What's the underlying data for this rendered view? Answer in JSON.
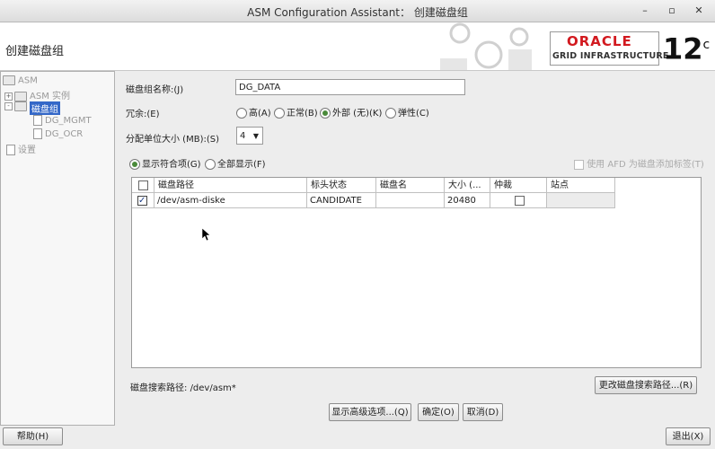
{
  "window": {
    "title": "ASM Configuration Assistant： 创建磁盘组",
    "minimize": "–",
    "maximize": "▫",
    "close": "✕"
  },
  "header": {
    "title": "创建磁盘组",
    "brand": "ORACLE",
    "product": "GRID INFRASTRUCTURE",
    "version": "12",
    "version_suffix": "c"
  },
  "tree": {
    "root": "ASM",
    "instances": "ASM 实例",
    "diskgroups": "磁盘组",
    "dg1": "DG_MGMT",
    "dg2": "DG_OCR",
    "settings": "设置"
  },
  "form": {
    "name_label": "磁盘组名称:(J)",
    "name_value": "DG_DATA",
    "redundancy_label": "冗余:(E)",
    "redundancy_options": [
      "高(A)",
      "正常(B)",
      "外部 (无)(K)",
      "弹性(C)"
    ],
    "redundancy_selected": "外部 (无)(K)",
    "au_label": "分配单位大小 (MB):(S)",
    "au_value": "4",
    "show_eligible": "显示符合项(G)",
    "show_all": "全部显示(F)",
    "afd_label": "使用 AFD 为磁盘添加标签(T)"
  },
  "table": {
    "columns": [
      "磁盘路径",
      "标头状态",
      "磁盘名",
      "大小 (...",
      "仲裁",
      "站点"
    ],
    "rows": [
      {
        "path": "/dev/asm-diske",
        "status": "CANDIDATE",
        "name": "",
        "size": "20480",
        "quorum": false,
        "site": "",
        "selected": true
      }
    ]
  },
  "search_path": {
    "label": "磁盘搜索路径:",
    "value": "/dev/asm*",
    "change_button": "更改磁盘搜索路径...(R)"
  },
  "buttons": {
    "advanced": "显示高级选项...(Q)",
    "ok": "确定(O)",
    "cancel": "取消(D)",
    "help": "帮助(H)",
    "exit": "退出(X)"
  }
}
